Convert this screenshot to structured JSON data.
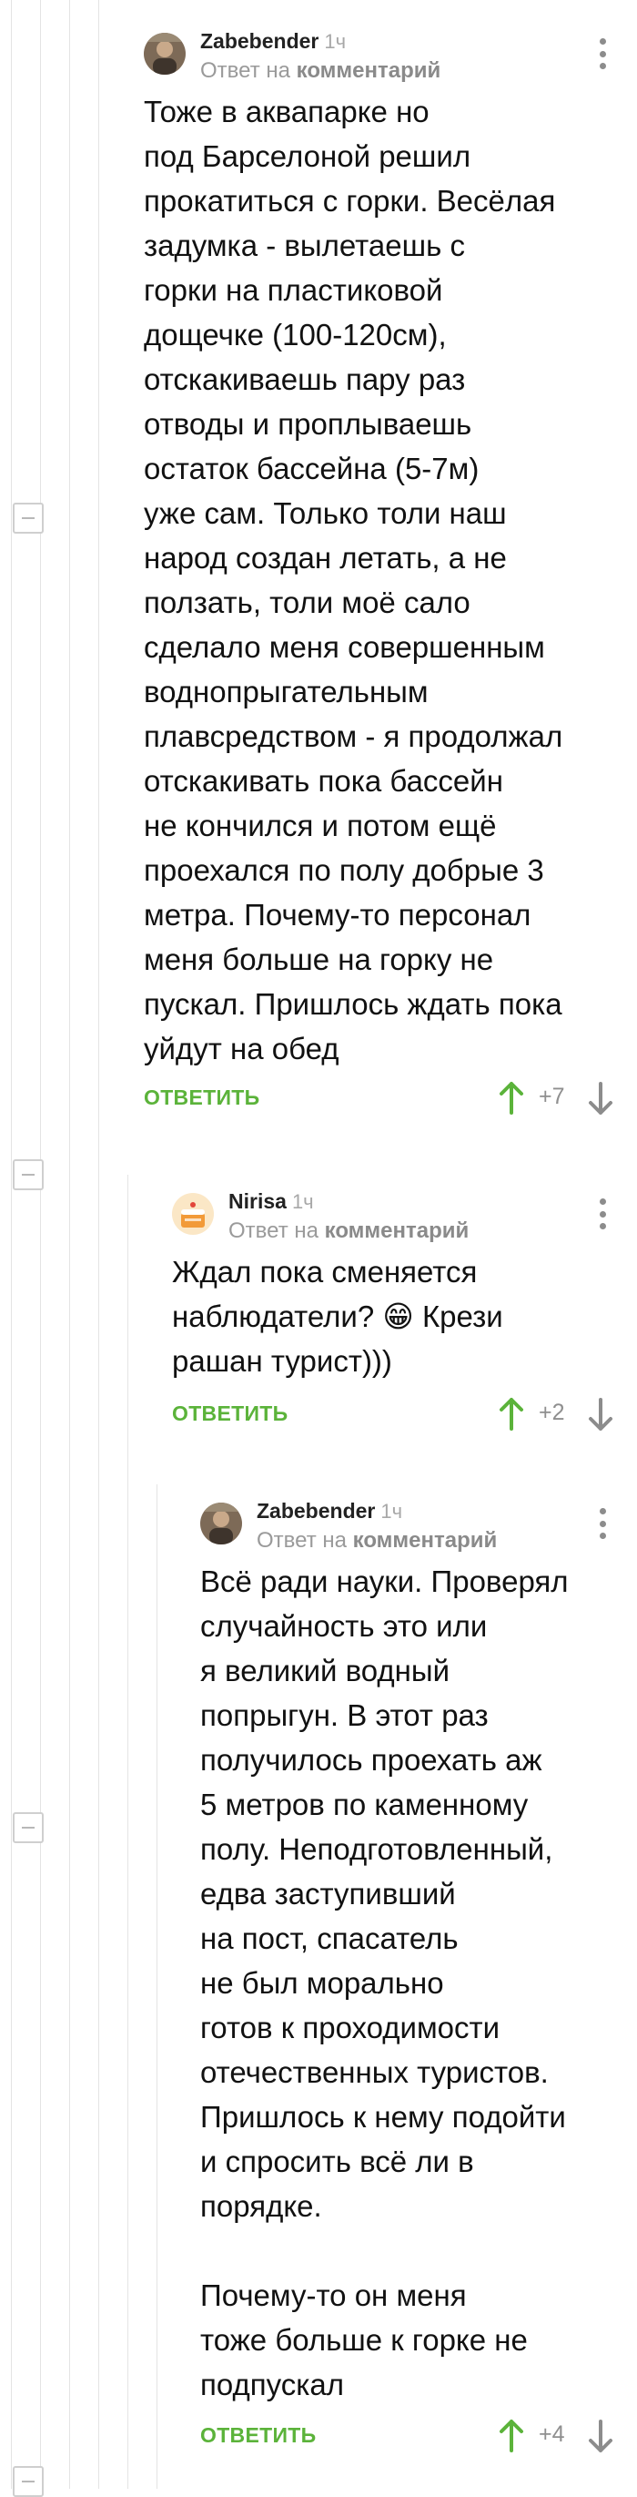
{
  "colors": {
    "accent_green": "#5bb33a",
    "vote_down": "#8c8c8c",
    "muted_text": "#9a9a9a",
    "thread_line": "#e4e4e4"
  },
  "comments": [
    {
      "author": "Zabebender",
      "time": "1ч",
      "reply_prefix": "Ответ на",
      "reply_target": "комментарий",
      "text": "Тоже в аквапарке но\nпод Барселоной решил\nпрокатиться с горки. Весёлая\nзадумка - вылетаешь с\nгорки на пластиковой\nдощечке (100-120см),\nотскакиваешь пару раз\nотводы и проплываешь\nостаток бассейна (5-7м)\nуже сам. Только толи наш\nнарод создан летать, а не\nползать, толи моё сало\nсделало меня совершенным\nводнопрыгательным\nплавсредством - я продолжал\nотскакивать пока бассейн\nне кончился и потом ещё\nпроехался по полу добрые 3\nметра. Почему-то персонал\nменя больше на горку не\nпускал. Пришлось ждать пока\nуйдут на обед",
      "reply_label": "ОТВЕТИТЬ",
      "score": "+7",
      "avatar_icon": "user-avatar-photo"
    },
    {
      "author": "Nirisa",
      "time": "1ч",
      "reply_prefix": "Ответ на",
      "reply_target": "комментарий",
      "text": "Ждал пока сменяется\nнаблюдатели? 😁 Крези\nрашан турист)))",
      "reply_label": "ОТВЕТИТЬ",
      "score": "+2",
      "avatar_icon": "cake-avatar"
    },
    {
      "author": "Zabebender",
      "time": "1ч",
      "reply_prefix": "Ответ на",
      "reply_target": "комментарий",
      "text": "Всё ради науки. Проверял\nслучайность это или\nя великий водный\nпопрыгун. В этот раз\nполучилось проехать аж\n5 метров по каменному\nполу. Неподготовленный,\nедва заступивший\nна пост, спасатель\nне был морально\nготов к проходимости\nотечественных туристов.\nПришлось к нему подойти\nи спросить всё ли в\nпорядке.\n\nПочему-то он меня\nтоже больше к горке не\nподпускал",
      "reply_label": "ОТВЕТИТЬ",
      "score": "+4",
      "avatar_icon": "user-avatar-photo"
    }
  ]
}
